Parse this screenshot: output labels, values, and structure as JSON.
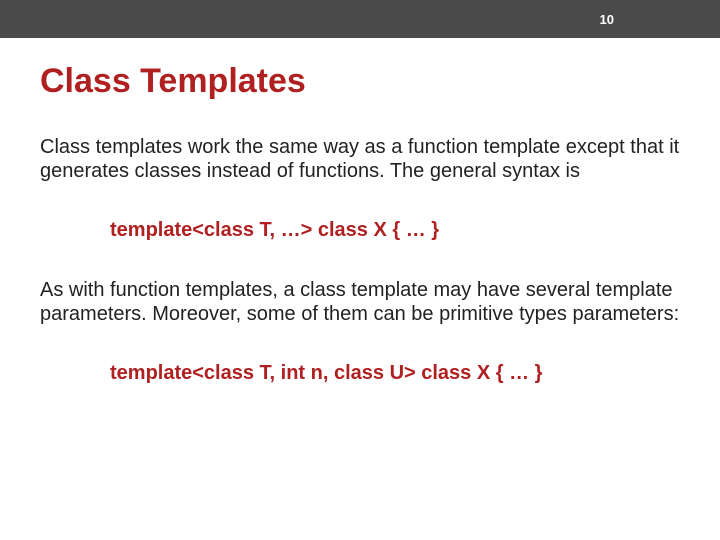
{
  "header": {
    "page_number": "10"
  },
  "title": "Class Templates",
  "para1": "Class templates work the same way as a function template except that it generates classes instead of functions.  The general syntax is",
  "code1": "template<class T, …> class X { … }",
  "para2": "As with function templates, a class template may have several template parameters.  Moreover, some of them can be primitive types parameters:",
  "code2": "template<class T, int n, class U> class X { … }"
}
